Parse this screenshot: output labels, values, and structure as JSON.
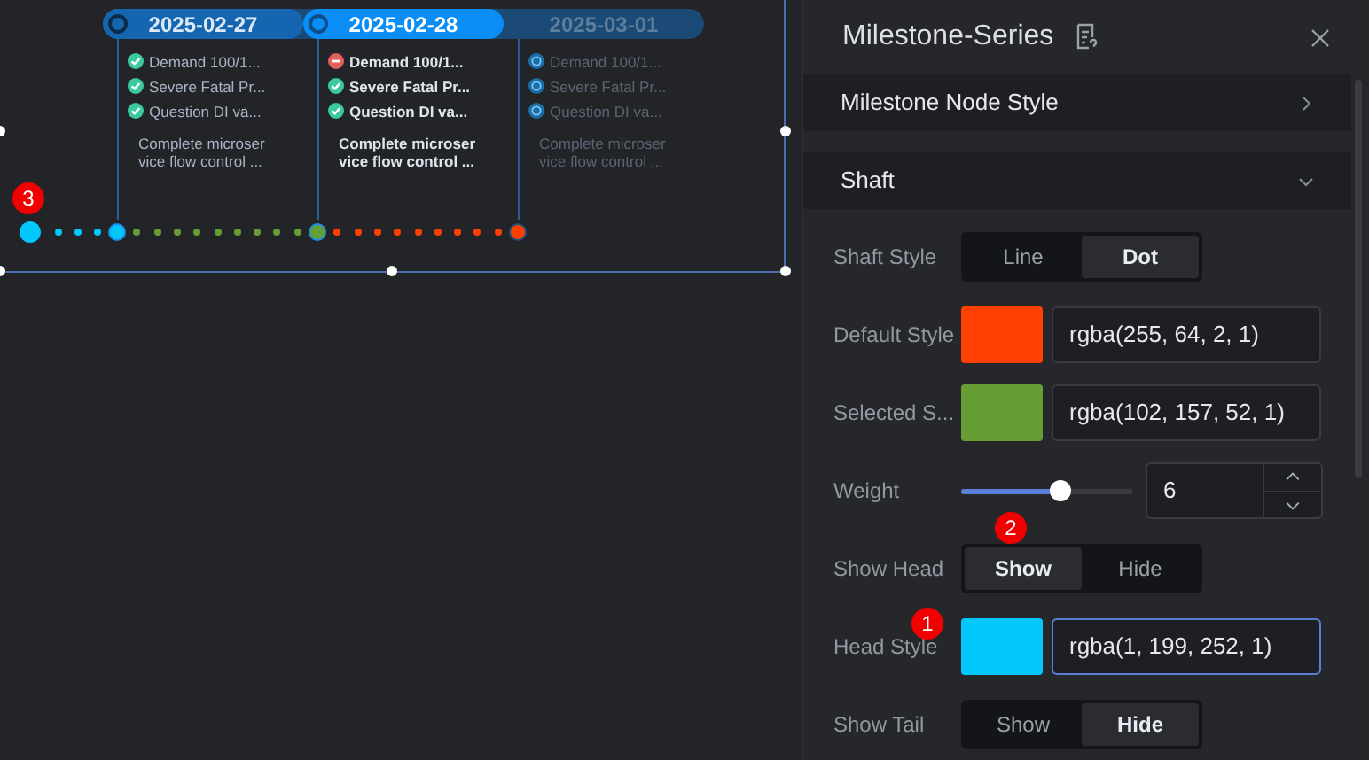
{
  "milestones": [
    {
      "date": "2025-02-27",
      "selected": false,
      "upcoming": false,
      "tasks": [
        {
          "text": "Demand 100/1...",
          "kind": "done"
        },
        {
          "text": "Severe Fatal Pr...",
          "kind": "done"
        },
        {
          "text": "Question DI va...",
          "kind": "done"
        }
      ],
      "description": "Complete microser vice flow control ..."
    },
    {
      "date": "2025-02-28",
      "selected": true,
      "upcoming": false,
      "tasks": [
        {
          "text": "Demand 100/1...",
          "kind": "blocked"
        },
        {
          "text": "Severe Fatal Pr...",
          "kind": "done"
        },
        {
          "text": "Question DI va...",
          "kind": "done"
        }
      ],
      "description": "Complete microser vice flow control ..."
    },
    {
      "date": "2025-03-01",
      "selected": false,
      "upcoming": true,
      "tasks": [
        {
          "text": "Demand 100/1...",
          "kind": "pending"
        },
        {
          "text": "Severe Fatal Pr...",
          "kind": "pending"
        },
        {
          "text": "Question DI va...",
          "kind": "pending"
        }
      ],
      "description": "Complete microser vice flow control ..."
    }
  ],
  "panel": {
    "title": "Milestone-Series",
    "sections": [
      {
        "title": "Milestone Node Style",
        "expanded": false
      },
      {
        "title": "Shaft",
        "expanded": true
      }
    ],
    "fields": [
      {
        "kind": "segmented",
        "label": "Shaft Style",
        "options": [
          {
            "label": "Line",
            "selected": false
          },
          {
            "label": "Dot",
            "selected": true
          }
        ]
      },
      {
        "kind": "color",
        "label": "Default Style",
        "color": "#ff4002",
        "value": "rgba(255, 64, 2, 1)",
        "focused": false
      },
      {
        "kind": "color",
        "label": "Selected S...",
        "color": "#669d34",
        "value": "rgba(102, 157, 52, 1)",
        "focused": false
      },
      {
        "kind": "slider",
        "label": "Weight",
        "level": 0.58,
        "value": "6"
      },
      {
        "kind": "segmented",
        "label": "Show Head",
        "options": [
          {
            "label": "Show",
            "selected": true
          },
          {
            "label": "Hide",
            "selected": false
          }
        ]
      },
      {
        "kind": "color",
        "label": "Head Style",
        "color": "#01c7fc",
        "value": "rgba(1, 199, 252, 1)",
        "focused": true
      },
      {
        "kind": "segmented",
        "label": "Show Tail",
        "options": [
          {
            "label": "Show",
            "selected": false
          },
          {
            "label": "Hide",
            "selected": true
          }
        ]
      }
    ]
  },
  "markers": [
    {
      "text": "3"
    },
    {
      "text": "2"
    },
    {
      "text": "1"
    }
  ]
}
